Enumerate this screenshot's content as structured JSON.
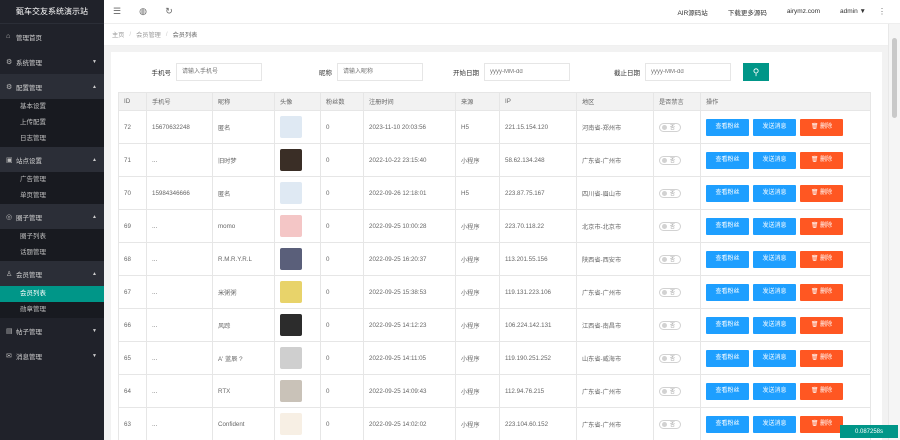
{
  "sidebar": {
    "title": "甄车交友系统演示站",
    "groups": [
      {
        "label": "管理首页",
        "icon": "home-icon",
        "arrow": "",
        "items": []
      },
      {
        "label": "系统管理",
        "icon": "gear-icon",
        "arrow": "▼",
        "items": []
      },
      {
        "label": "配置管理",
        "icon": "settings-icon",
        "arrow": "▲",
        "items": [
          "基本设置",
          "上传配置",
          "日志管理"
        ]
      },
      {
        "label": "站点设置",
        "icon": "site-icon",
        "arrow": "▲",
        "items": [
          "广告管理",
          "单页管理"
        ]
      },
      {
        "label": "圈子管理",
        "icon": "circle-icon",
        "arrow": "▲",
        "items": [
          "圈子列表",
          "话题管理"
        ]
      },
      {
        "label": "会员管理",
        "icon": "user-icon",
        "arrow": "▲",
        "items": [
          "会员列表",
          "勋章管理"
        ]
      },
      {
        "label": "帖子管理",
        "icon": "post-icon",
        "arrow": "▼",
        "items": []
      },
      {
        "label": "消息管理",
        "icon": "message-icon",
        "arrow": "▼",
        "items": []
      }
    ],
    "active_item": "会员列表"
  },
  "topbar": {
    "icons": [
      "menu-icon",
      "globe-icon",
      "refresh-icon"
    ],
    "links": [
      "AIR源码站",
      "下载更多源码",
      "airymz.com"
    ],
    "user": "admin ▼",
    "more": "⋮"
  },
  "breadcrumb": [
    "主页",
    "会员管理",
    "会员列表"
  ],
  "search": {
    "fields": [
      {
        "label": "手机号",
        "placeholder": "请输入手机号"
      },
      {
        "label": "昵称",
        "placeholder": "请输入昵称"
      },
      {
        "label": "开始日期",
        "placeholder": "yyyy-MM-dd"
      },
      {
        "label": "截止日期",
        "placeholder": "yyyy-MM-dd"
      }
    ],
    "button_icon": "search-icon"
  },
  "table": {
    "headers": [
      "ID",
      "手机号",
      "昵称",
      "头像",
      "粉丝数",
      "注册时间",
      "来源",
      "IP",
      "地区",
      "是否禁言",
      "操作"
    ],
    "rows": [
      {
        "id": "72",
        "phone": "15670632248",
        "nick": "匿名",
        "avatar": "#dfe9f3",
        "fans": "0",
        "time": "2023-11-10 20:03:56",
        "src": "H5",
        "ip": "221.15.154.120",
        "area": "河南省-郑州市"
      },
      {
        "id": "71",
        "phone": "...",
        "nick": "旧时梦",
        "avatar": "#3a2e26",
        "fans": "0",
        "time": "2022-10-22 23:15:40",
        "src": "小程序",
        "ip": "58.62.134.248",
        "area": "广东省-广州市"
      },
      {
        "id": "70",
        "phone": "15984346666",
        "nick": "匿名",
        "avatar": "#dfe9f3",
        "fans": "0",
        "time": "2022-09-26 12:18:01",
        "src": "H5",
        "ip": "223.87.75.167",
        "area": "四川省-眉山市"
      },
      {
        "id": "69",
        "phone": "...",
        "nick": "momo",
        "avatar": "#f4c6c6",
        "fans": "0",
        "time": "2022-09-25 10:00:28",
        "src": "小程序",
        "ip": "223.70.118.22",
        "area": "北京市-北京市"
      },
      {
        "id": "68",
        "phone": "...",
        "nick": "R.M.R.Y.R.L",
        "avatar": "#5a5f7a",
        "fans": "0",
        "time": "2022-09-25 16:20:37",
        "src": "小程序",
        "ip": "113.201.55.156",
        "area": "陕西省-西安市"
      },
      {
        "id": "67",
        "phone": "...",
        "nick": "米粥粥",
        "avatar": "#e8d36a",
        "fans": "0",
        "time": "2022-09-25 15:38:53",
        "src": "小程序",
        "ip": "119.131.223.106",
        "area": "广东省-广州市"
      },
      {
        "id": "66",
        "phone": "...",
        "nick": "风踪",
        "avatar": "#2c2c2c",
        "fans": "0",
        "time": "2022-09-25 14:12:23",
        "src": "小程序",
        "ip": "106.224.142.131",
        "area": "江西省-南昌市"
      },
      {
        "id": "65",
        "phone": "...",
        "nick": "A' 蓝辰 ?",
        "avatar": "#cfcfcf",
        "fans": "0",
        "time": "2022-09-25 14:11:05",
        "src": "小程序",
        "ip": "119.190.251.252",
        "area": "山东省-威海市"
      },
      {
        "id": "64",
        "phone": "...",
        "nick": "RTX",
        "avatar": "#c9c2b8",
        "fans": "0",
        "time": "2022-09-25 14:09:43",
        "src": "小程序",
        "ip": "112.94.76.215",
        "area": "广东省-广州市"
      },
      {
        "id": "63",
        "phone": "...",
        "nick": "Confident",
        "avatar": "#f7efe4",
        "fans": "0",
        "time": "2022-09-25 14:02:02",
        "src": "小程序",
        "ip": "223.104.60.152",
        "area": "广东省-广州市"
      }
    ],
    "toggle_label": "否",
    "actions": {
      "view": "查看粉丝",
      "message": "发送消息",
      "delete": "删除",
      "delete_icon": "trash-icon"
    }
  },
  "status_badge": "0.087258s",
  "colors": {
    "sidebar": "#20222a",
    "accent": "#009688",
    "blue": "#1e9fff",
    "red": "#ff5722"
  }
}
